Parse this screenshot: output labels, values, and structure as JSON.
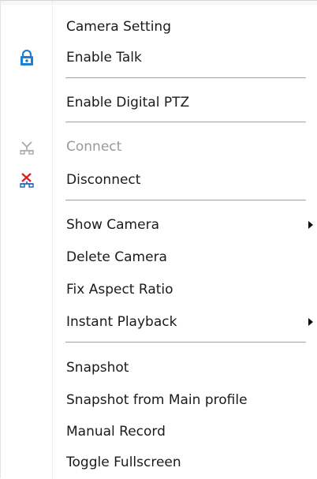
{
  "menu": {
    "items": {
      "camera_setting": "Camera Setting",
      "enable_talk": "Enable Talk",
      "enable_digital_ptz": "Enable Digital PTZ",
      "connect": "Connect",
      "disconnect": "Disconnect",
      "show_camera": "Show Camera",
      "delete_camera": "Delete Camera",
      "fix_aspect_ratio": "Fix Aspect Ratio",
      "instant_playback": "Instant Playback",
      "snapshot": "Snapshot",
      "snapshot_main_profile": "Snapshot from Main profile",
      "manual_record": "Manual Record",
      "toggle_fullscreen": "Toggle Fullscreen"
    },
    "icons": {
      "enable_talk": "talk-lock-icon",
      "connect": "connect-icon",
      "disconnect": "disconnect-icon",
      "submenu": "submenu-arrow-icon"
    },
    "states": {
      "connect_enabled": false
    },
    "colors": {
      "talk_icon": "#1f7fd1",
      "disconnect_x": "#e02020",
      "disconnect_link": "#1c5fb8",
      "disabled_text": "#9a9a9a"
    }
  }
}
